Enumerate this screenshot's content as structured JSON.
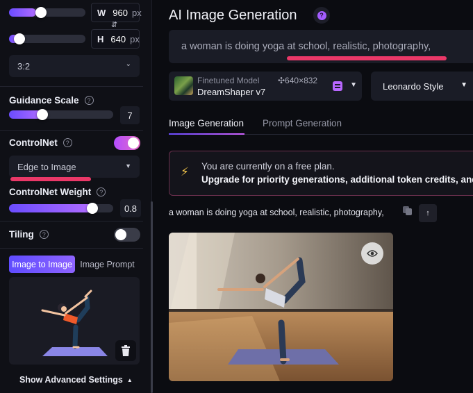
{
  "sidebar": {
    "width_box": {
      "label": "W",
      "value": "960",
      "unit": "px"
    },
    "height_box": {
      "label": "H",
      "value": "640",
      "unit": "px"
    },
    "swap_glyph": "⇵",
    "width_slider_fraction": 0.32,
    "height_slider_fraction": 0.1,
    "aspect_ratio": {
      "value": "3:2"
    },
    "guidance_scale": {
      "label": "Guidance Scale",
      "value": "7",
      "slider_fraction": 0.32
    },
    "controlnet": {
      "label": "ControlNet",
      "enabled": true,
      "mode_value": "Edge to Image"
    },
    "controlnet_weight": {
      "label": "ControlNet Weight",
      "value": "0.8",
      "slider_fraction": 0.8
    },
    "tiling": {
      "label": "Tiling",
      "enabled": false
    },
    "image_tabs": [
      {
        "label": "Image to Image",
        "active": true
      },
      {
        "label": "Image Prompt",
        "active": false
      }
    ],
    "show_advanced": "Show Advanced Settings",
    "help_glyph": "?"
  },
  "main": {
    "title": "AI Image Generation",
    "help_glyph": "?",
    "prompt_text": "a woman is doing yoga at school, realistic, photography,",
    "model": {
      "sublabel": "Finetuned Model",
      "name": "DreamShaper v7",
      "dimensions": "✣640×832"
    },
    "style_select": "Leonardo Style",
    "tabs": [
      {
        "label": "Image Generation",
        "active": true
      },
      {
        "label": "Prompt Generation",
        "active": false
      }
    ],
    "notice": {
      "line1": "You are currently on a free plan.",
      "line2": "Upgrade for priority generations, additional token credits, and m"
    },
    "generation_prompt": "a woman is doing yoga at school, realistic, photography,",
    "upload_glyph": "↑"
  },
  "colors": {
    "accent": "#7b5cff",
    "toggle_on": "#c45be8",
    "annotation_red": "#ea3868",
    "background": "#0b0c11"
  },
  "icons": [
    "swap-vertical-icon",
    "chevron-down-icon",
    "help-circle-icon",
    "lightning-icon",
    "copy-icon",
    "arrow-up-icon",
    "trash-icon",
    "eye-icon",
    "prompt-doc-icon"
  ]
}
